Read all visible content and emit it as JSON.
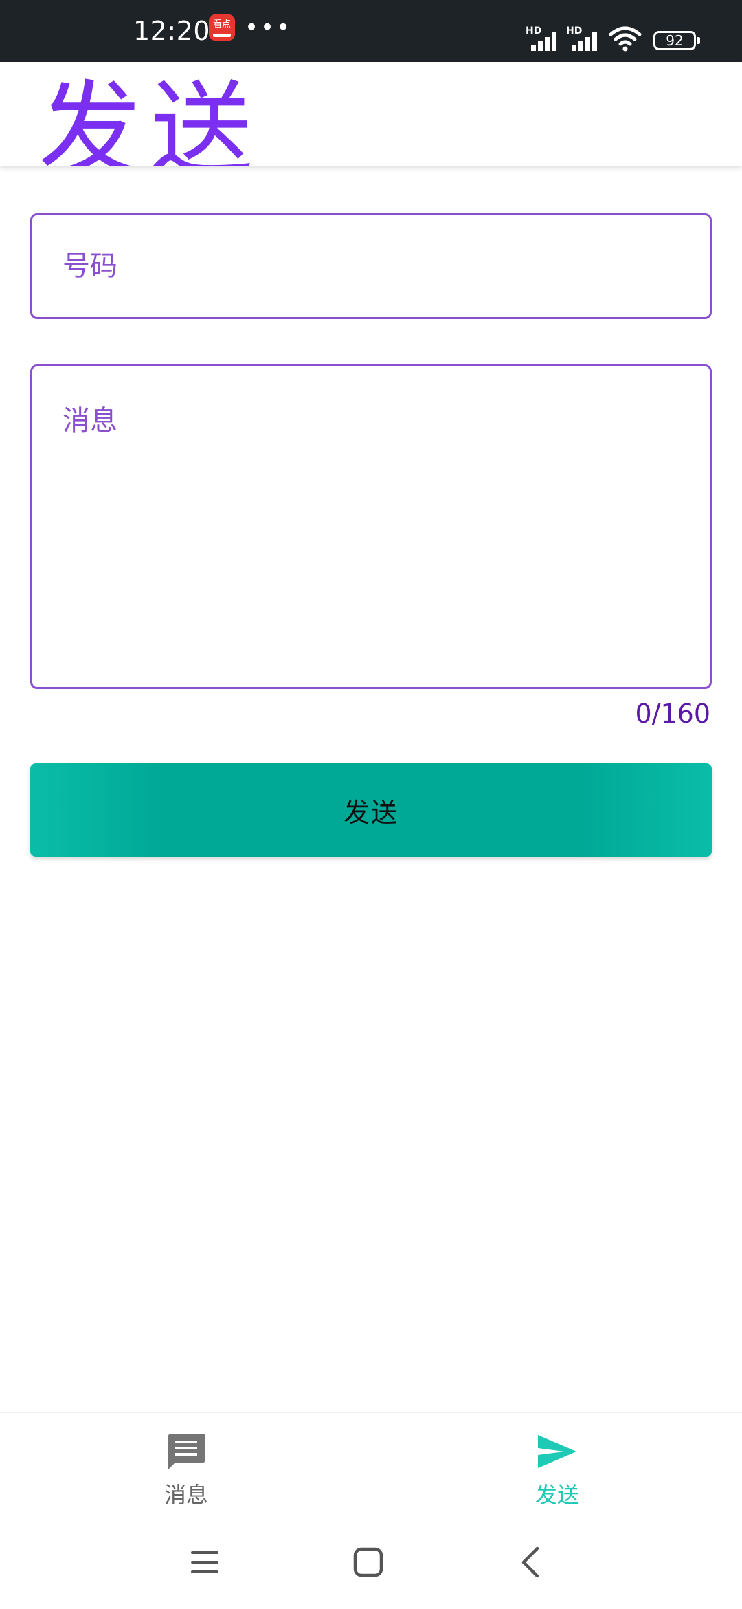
{
  "status_bar": {
    "time": "12:20",
    "app_badge_text": "看点",
    "more_dots": "•••",
    "signal_1_label": "HD",
    "signal_2_label": "HD",
    "battery_level": "92"
  },
  "header": {
    "title": "发送"
  },
  "form": {
    "number_placeholder": "号码",
    "number_value": "",
    "message_placeholder": "消息",
    "message_value": "",
    "char_counter": "0/160",
    "send_label": "发送"
  },
  "bottom_nav": {
    "items": [
      {
        "label": "消息",
        "icon": "message-icon",
        "active": false
      },
      {
        "label": "发送",
        "icon": "send-icon",
        "active": true
      }
    ]
  },
  "system_nav": {
    "menu_icon": "menu-icon",
    "home_icon": "home-icon",
    "back_icon": "back-icon"
  },
  "colors": {
    "accent_purple": "#7b2ff0",
    "field_border": "#8a4fcf",
    "button_teal": "#00a896",
    "active_nav": "#1ec9b5",
    "status_bar_bg": "#1e2327"
  }
}
